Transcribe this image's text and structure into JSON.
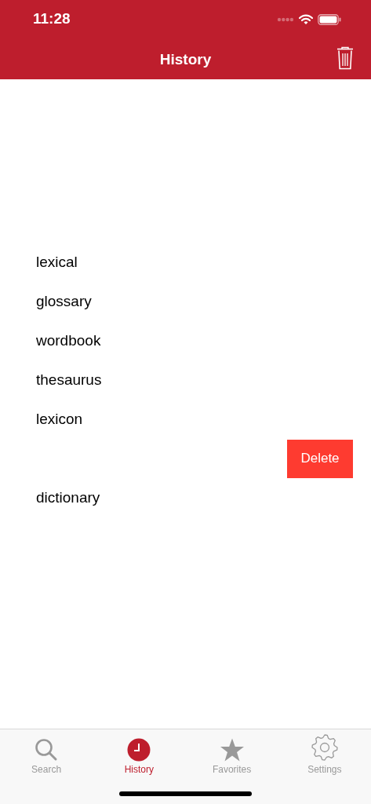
{
  "status_bar": {
    "time": "11:28"
  },
  "nav_bar": {
    "title": "History"
  },
  "history": [
    {
      "kind": "word",
      "text": "lexical"
    },
    {
      "kind": "word",
      "text": "glossary"
    },
    {
      "kind": "word",
      "text": "wordbook"
    },
    {
      "kind": "word",
      "text": "thesaurus"
    },
    {
      "kind": "word",
      "text": "lexicon"
    },
    {
      "kind": "swiped",
      "action": "Delete"
    },
    {
      "kind": "word",
      "text": "dictionary"
    }
  ],
  "tab_bar": [
    {
      "label": "Search",
      "kind": "search",
      "selected": false
    },
    {
      "label": "History",
      "kind": "clock",
      "selected": true
    },
    {
      "label": "Favorites",
      "kind": "star",
      "selected": false
    },
    {
      "label": "Settings",
      "kind": "gear",
      "selected": false
    }
  ]
}
